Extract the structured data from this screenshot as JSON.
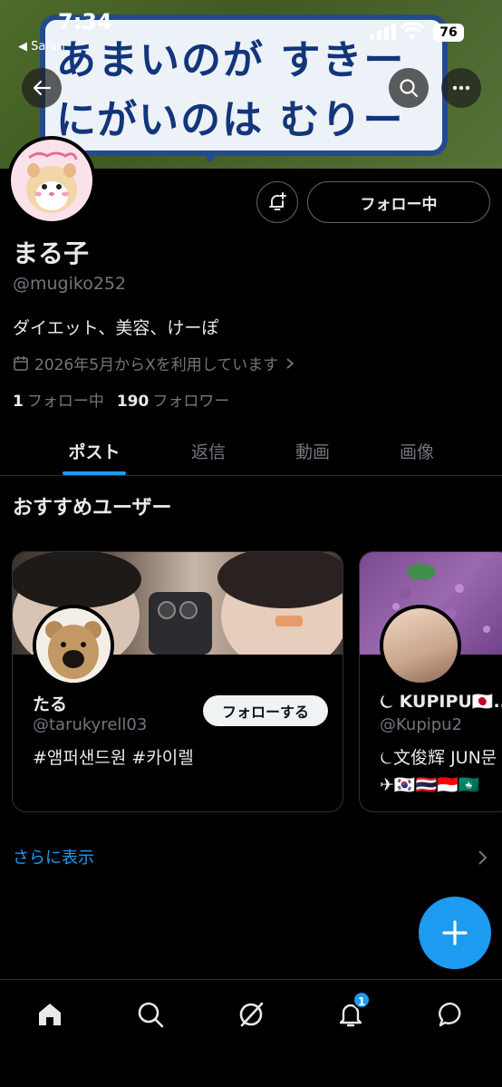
{
  "status_bar": {
    "time": "7:34",
    "back_app": "◀ Safari",
    "battery": "76"
  },
  "banner": {
    "line1": "あまいのが すきー",
    "line2": "にがいのは むりー"
  },
  "profile": {
    "follow_button": "フォロー中",
    "name": "まる子",
    "handle": "@mugiko252",
    "bio": "ダイエット、美容、けーぽ",
    "joined": "2026年5月からXを利用しています",
    "following_count": "1",
    "following_label": "フォロー中",
    "followers_count": "190",
    "followers_label": "フォロワー"
  },
  "tabs": [
    {
      "label": "ポスト",
      "active": true
    },
    {
      "label": "返信",
      "active": false
    },
    {
      "label": "動画",
      "active": false
    },
    {
      "label": "画像",
      "active": false
    }
  ],
  "recommendations": {
    "title": "おすすめユーザー",
    "cards": [
      {
        "name": "たる",
        "handle": "@tarukyrell03",
        "bio": "#앰퍼샌드원 #카이렐",
        "follow_button": "フォローする"
      },
      {
        "name": "⏾ KUPIPU🇯🇵..",
        "handle": "@Kupipu2",
        "bio_line1": "⏾文俊辉 JUN문",
        "bio_line2": "✈🇰🇷🇹🇭🇮🇩🇲🇴"
      }
    ],
    "show_more": "さらに表示"
  },
  "bottom_nav": {
    "notifications_badge": "1"
  },
  "colors": {
    "accent": "#1d9bf0",
    "background": "#000000",
    "text_primary": "#e7e9ea",
    "text_secondary": "#71767b"
  }
}
